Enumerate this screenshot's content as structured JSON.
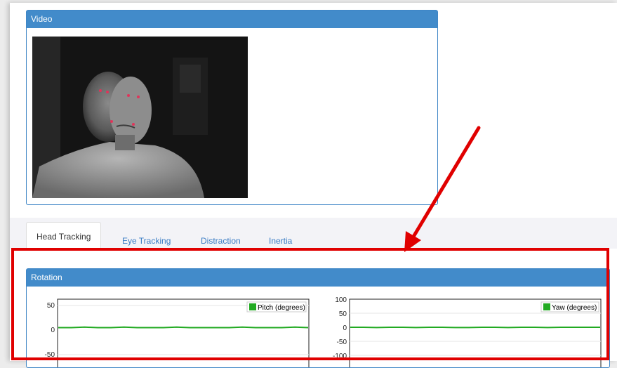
{
  "video_panel": {
    "title": "Video"
  },
  "tabs": [
    {
      "label": "Head Tracking",
      "active": true
    },
    {
      "label": "Eye Tracking",
      "active": false
    },
    {
      "label": "Distraction",
      "active": false
    },
    {
      "label": "Inertia",
      "active": false
    }
  ],
  "rotation_panel": {
    "title": "Rotation"
  },
  "colors": {
    "panel_header": "#428bca",
    "series_line": "#22aa22",
    "highlight": "#e00000"
  },
  "chart_data": [
    {
      "type": "line",
      "series": [
        {
          "name": "Pitch (degrees)",
          "values": [
            5,
            5,
            6,
            5,
            5,
            6,
            5,
            5,
            5,
            6,
            5,
            5,
            5,
            5,
            6,
            5,
            5,
            5,
            6,
            5
          ]
        }
      ],
      "y_ticks": [
        "50",
        "0",
        "-50"
      ],
      "ylim": [
        -65,
        65
      ],
      "grid": true,
      "legend": "top-right"
    },
    {
      "type": "line",
      "series": [
        {
          "name": "Yaw (degrees)",
          "values": [
            0,
            0,
            -1,
            0,
            0,
            -1,
            0,
            0,
            -1,
            -1,
            0,
            0,
            -1,
            0,
            0,
            -1,
            0,
            0,
            0,
            0
          ]
        }
      ],
      "y_ticks": [
        "100",
        "50",
        "0",
        "-50",
        "-100"
      ],
      "ylim": [
        -100,
        100
      ],
      "grid": true,
      "legend": "top-right"
    }
  ]
}
